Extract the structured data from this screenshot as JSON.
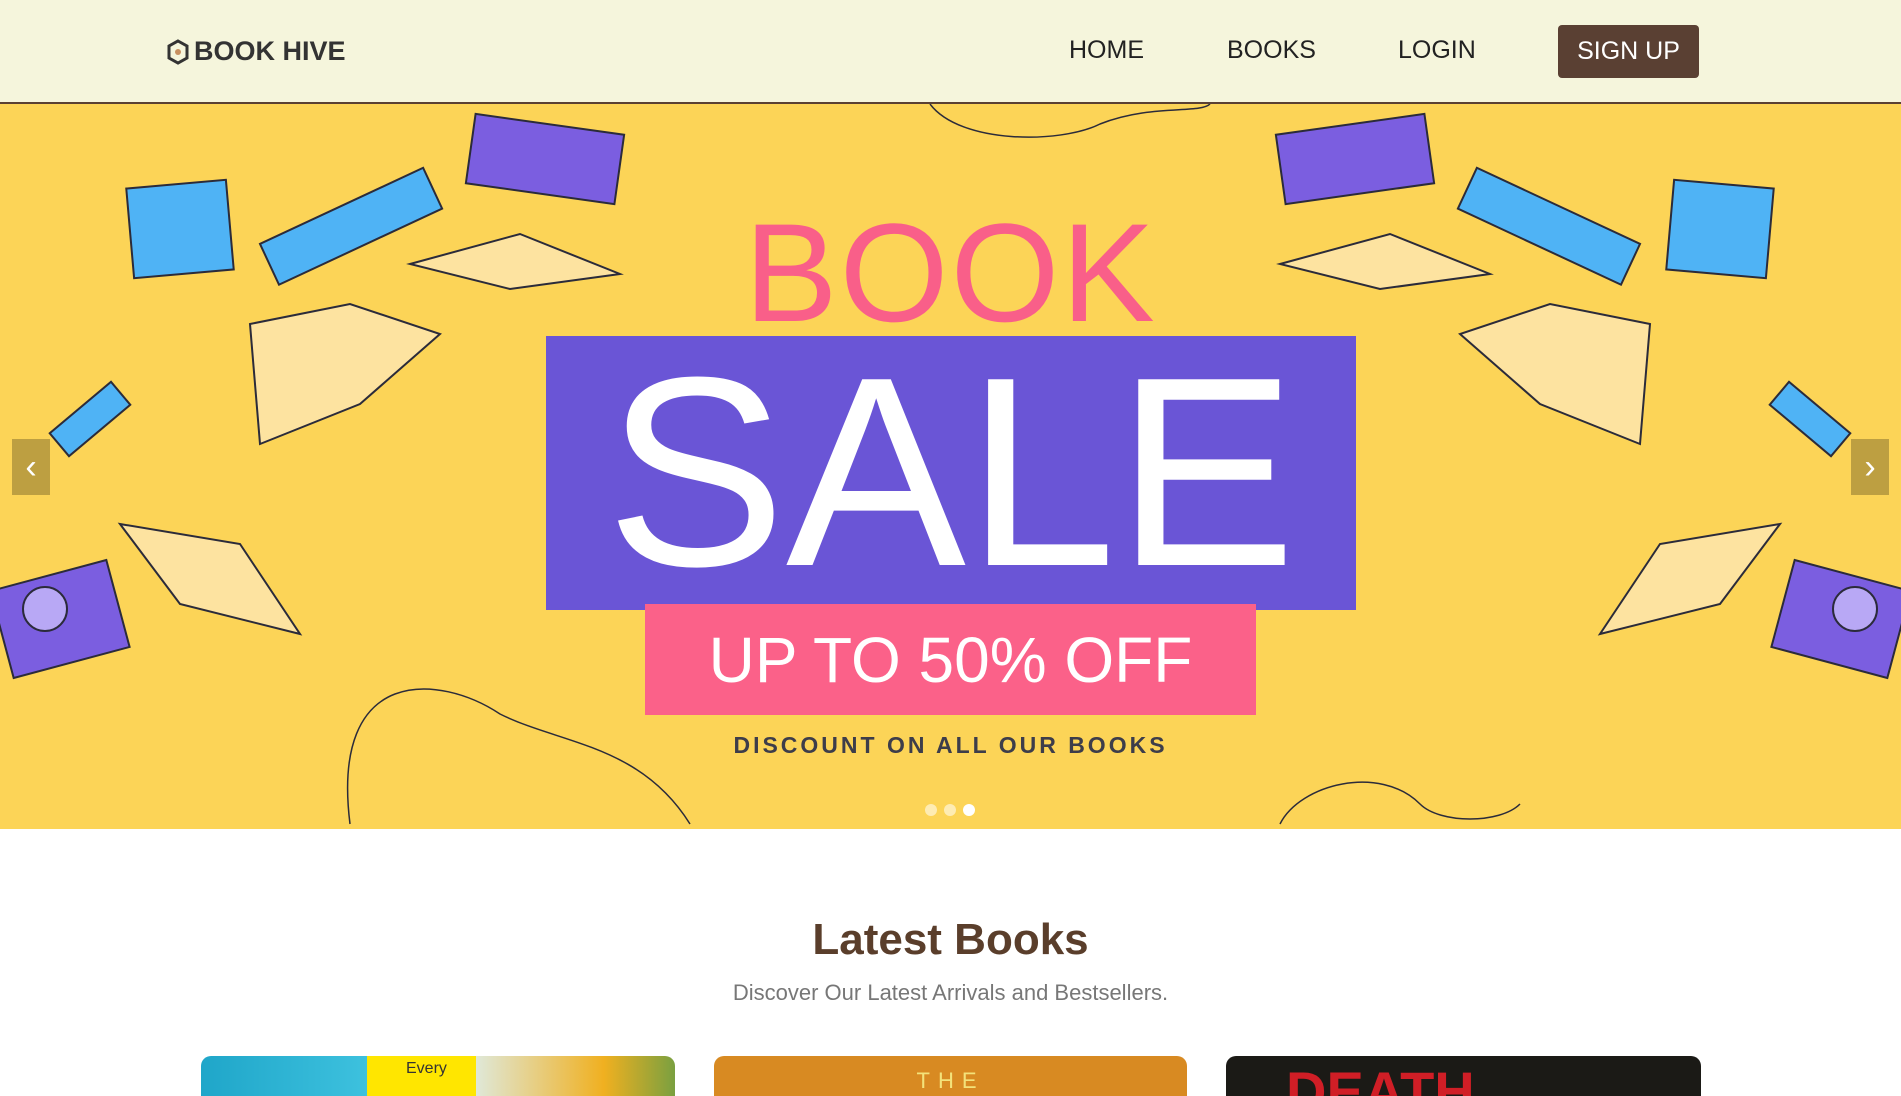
{
  "header": {
    "logo": "BOOK HIVE",
    "nav": [
      "HOME",
      "BOOKS",
      "LOGIN"
    ],
    "signup": "SIGN UP"
  },
  "banner": {
    "line1": "BOOK",
    "line2": "SALE",
    "line3": "UP TO 50% OFF",
    "line4": "DISCOUNT ON ALL OUR BOOKS",
    "slides": 3,
    "active_slide": 3,
    "prev_icon": "chevron-left-icon",
    "next_icon": "chevron-right-icon"
  },
  "section": {
    "title": "Latest Books",
    "subtitle": "Discover Our Latest Arrivals and Bestsellers."
  },
  "cards": [
    {
      "cover_text": "Every"
    },
    {
      "cover_text": "THE"
    },
    {
      "cover_text": "DEATH"
    }
  ],
  "colors": {
    "header_bg": "#f5f5dc",
    "brand": "#5a4033",
    "banner_bg": "#fcd457",
    "pink": "#fb6189",
    "purple": "#6a55d6"
  }
}
